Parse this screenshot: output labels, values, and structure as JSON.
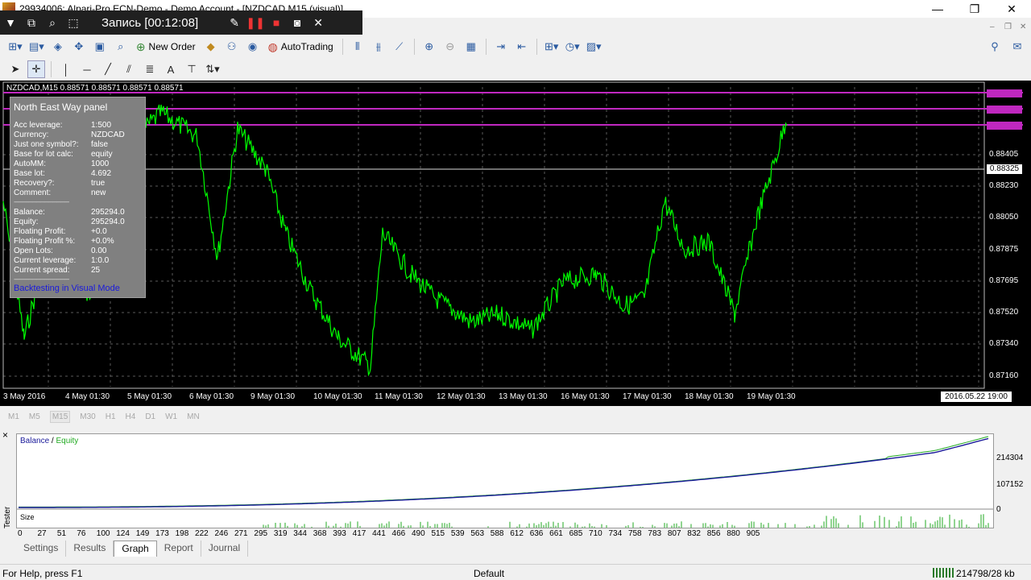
{
  "window": {
    "title": "29934006: Alpari-Pro.ECN-Demo - Demo Account - [NZDCAD,M15 (visual)]",
    "minimize": "—",
    "restore": "❐",
    "close": "✕"
  },
  "recorder": {
    "label": "Запись [00:12:08]"
  },
  "toolbar": {
    "new_order": "New Order",
    "autotrading": "AutoTrading",
    "label_tool": "A"
  },
  "chart": {
    "title": "NZDCAD,M15  0.88571 0.88571 0.88571 0.88571",
    "price_ticks": [
      "0.88405",
      "0.88230",
      "0.88050",
      "0.87875",
      "0.87695",
      "0.87520",
      "0.87340",
      "0.87160"
    ],
    "current_price": "0.88325",
    "highlight_prices": [
      "0.88750",
      "0.88658",
      "0.88572"
    ],
    "date_ticks": [
      "3 May 2016",
      "4 May 01:30",
      "5 May 01:30",
      "6 May 01:30",
      "9 May 01:30",
      "10 May 01:30",
      "11 May 01:30",
      "12 May 01:30",
      "13 May 01:30",
      "16 May 01:30",
      "17 May 01:30",
      "18 May 01:30",
      "19 May 01:30"
    ],
    "cursor_date": "2016.05.22 19:00",
    "line_color": "#00ff00",
    "level_color": "#c028c0"
  },
  "panel": {
    "title": "North East Way panel",
    "top_label": "Acc leverage:",
    "top_value": "1:500",
    "rows1": [
      {
        "k": "Currency:",
        "v": "NZDCAD"
      },
      {
        "k": "Just one symbol?:",
        "v": "false"
      },
      {
        "k": "Base for lot calc:",
        "v": "equity"
      },
      {
        "k": "AutoMM:",
        "v": "1000"
      },
      {
        "k": "Base lot:",
        "v": "4.692"
      },
      {
        "k": "Recovery?:",
        "v": "true"
      },
      {
        "k": "Comment:",
        "v": "new"
      }
    ],
    "divider": "-----------------------------------------",
    "rows2": [
      {
        "k": "Balance:",
        "v": "295294.0"
      },
      {
        "k": "Equity:",
        "v": "295294.0"
      },
      {
        "k": "Floating Profit:",
        "v": "+0.0"
      },
      {
        "k": "Floating Profit %:",
        "v": "+0.0%"
      },
      {
        "k": "Open Lots:",
        "v": "0.00"
      },
      {
        "k": "Current leverage:",
        "v": "1:0.0"
      },
      {
        "k": "Current spread:",
        "v": "25"
      }
    ],
    "link": "Backtesting in Visual Mode"
  },
  "timeframes": [
    "M1",
    "M5",
    "M15",
    "M30",
    "H1",
    "H4",
    "D1",
    "W1",
    "MN"
  ],
  "active_timeframe": "M15",
  "tester": {
    "side_label": "Tester",
    "close": "×",
    "legend_balance": "Balance",
    "legend_sep": " / ",
    "legend_equity": "Equity",
    "size_label": "Size",
    "y_ticks": [
      "214304",
      "107152",
      "0"
    ],
    "x_ticks": [
      "0",
      "27",
      "51",
      "76",
      "100",
      "124",
      "149",
      "173",
      "198",
      "222",
      "246",
      "271",
      "295",
      "319",
      "344",
      "368",
      "393",
      "417",
      "441",
      "466",
      "490",
      "515",
      "539",
      "563",
      "588",
      "612",
      "636",
      "661",
      "685",
      "710",
      "734",
      "758",
      "783",
      "807",
      "832",
      "856",
      "880",
      "905"
    ],
    "balance_color": "#1a1a9a",
    "equity_color": "#22aa22",
    "tabs": [
      "Settings",
      "Results",
      "Graph",
      "Report",
      "Journal"
    ],
    "active_tab": "Graph"
  },
  "status": {
    "help": "For Help, press F1",
    "profile": "Default",
    "traffic": "214798/28 kb"
  }
}
